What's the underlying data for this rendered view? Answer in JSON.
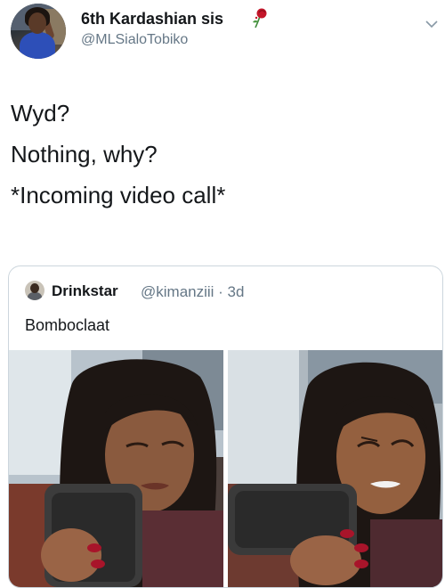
{
  "tweet": {
    "display_name": "6th Kardashian sis",
    "name_emoji_icon": "wilted-rose-icon",
    "handle": "@MLSialoTobiko",
    "menu_icon": "chevron-down-icon",
    "lines": [
      "Wyd?",
      "Nothing, why?",
      "*Incoming video call*"
    ]
  },
  "quoted_tweet": {
    "display_name": "Drinkstar",
    "handle_and_time": "@kimanziii · 3d",
    "text": "Bomboclaat",
    "photos": [
      "photo-woman-on-phone-eyes-closed",
      "photo-woman-on-phone-squinting"
    ]
  },
  "colors": {
    "text_primary": "#14171a",
    "text_secondary": "#657786",
    "border": "#ccd6dd"
  }
}
